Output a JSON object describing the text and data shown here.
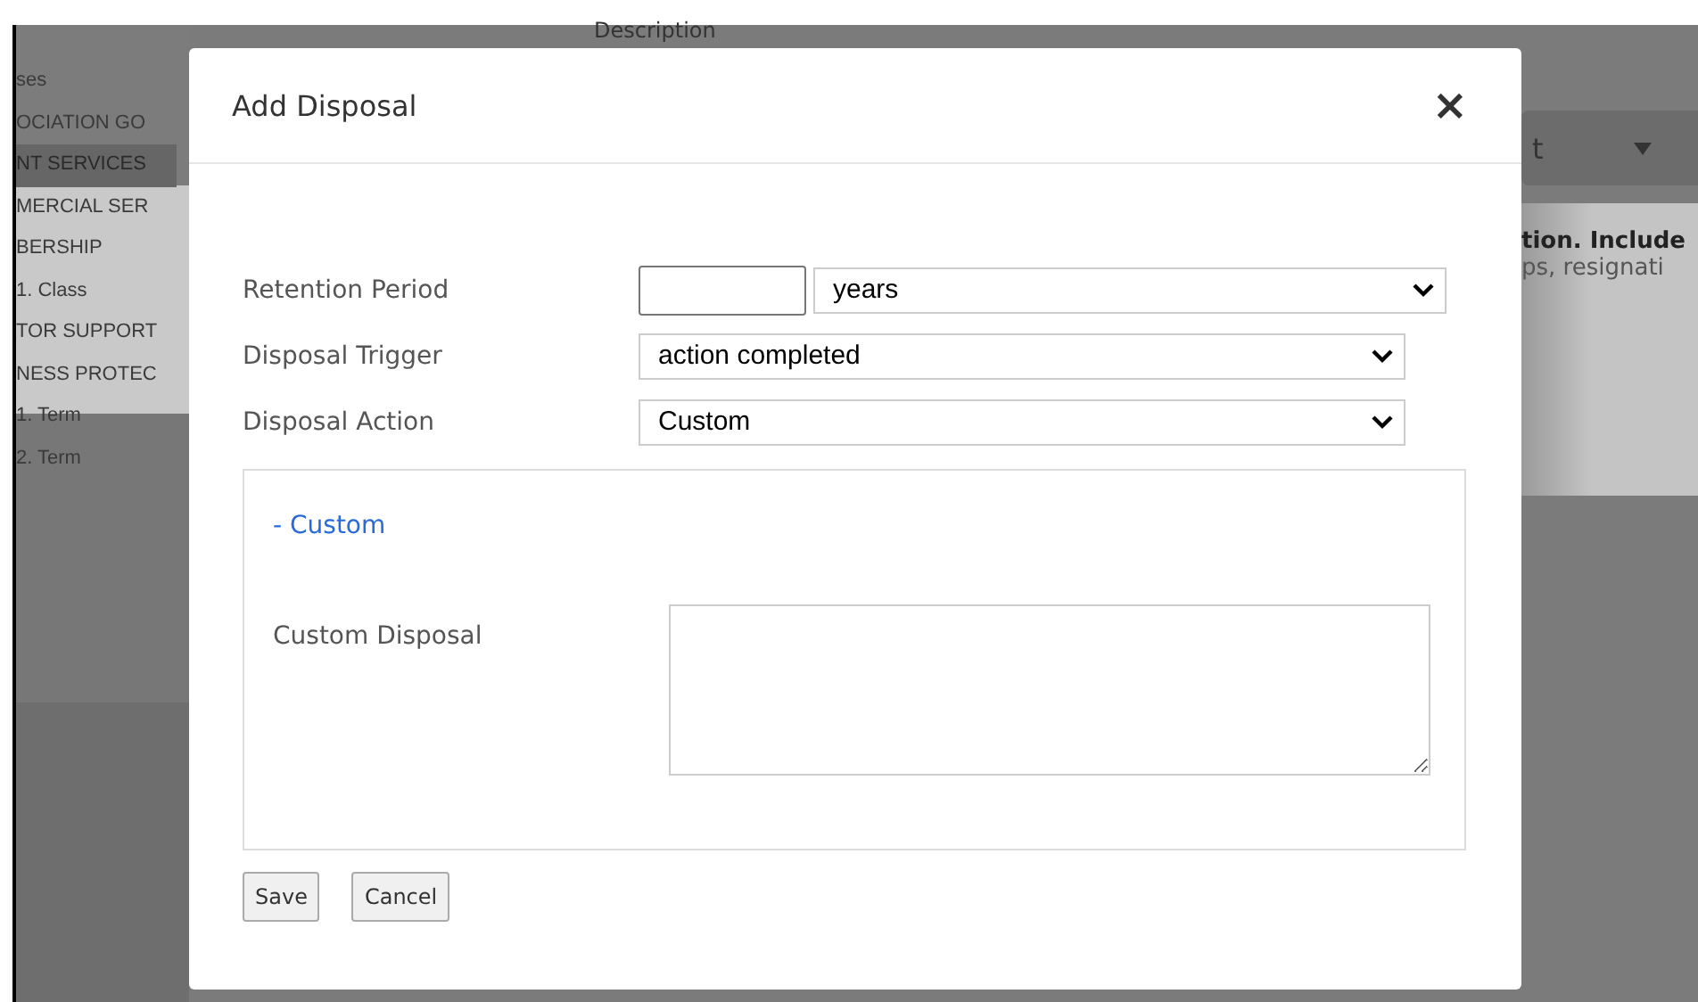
{
  "background": {
    "header_label": "Description",
    "sidebar_items": [
      {
        "label": "ses",
        "selected": false
      },
      {
        "label": "OCIATION GO",
        "selected": false
      },
      {
        "label": "NT SERVICES",
        "selected": true
      },
      {
        "label": "MERCIAL SER",
        "selected": false
      },
      {
        "label": "BERSHIP",
        "selected": false
      },
      {
        "label": "1. Class",
        "selected": false
      },
      {
        "label": "TOR SUPPORT",
        "selected": false
      },
      {
        "label": "NESS PROTEC",
        "selected": false
      },
      {
        "label": "1. Term",
        "selected": false
      },
      {
        "label": "2. Term",
        "selected": false
      }
    ],
    "dropdown_value": "t",
    "heading_fragment": "tion. Include",
    "text_fragment": "ps, resignati"
  },
  "dialog": {
    "title": "Add Disposal",
    "close": "×",
    "fields": [
      {
        "kind": "period",
        "label": "Retention Period",
        "unit": "years"
      },
      {
        "kind": "select",
        "label": "Disposal Trigger",
        "value": "action completed"
      },
      {
        "kind": "select",
        "label": "Disposal Action",
        "value": "Custom"
      }
    ],
    "section": {
      "toggle": "- Custom",
      "expanded": true,
      "field_label": "Custom Disposal"
    },
    "buttons": [
      "Save",
      "Cancel"
    ]
  }
}
